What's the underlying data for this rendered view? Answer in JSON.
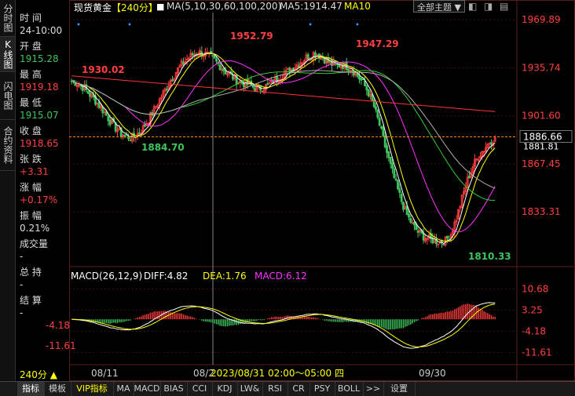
{
  "left_tabs": [
    "分时图",
    "K线图",
    "闪电图",
    "合约资料"
  ],
  "info_panel": [
    {
      "label": "时 间",
      "value": "24-10:00",
      "value_color": "#dddddd"
    },
    {
      "label": "开 盘",
      "value": "1915.28",
      "value_color": "#3ec45d"
    },
    {
      "label": "最 高",
      "value": "1919.18",
      "value_color": "#ff4040"
    },
    {
      "label": "最 低",
      "value": "1915.07",
      "value_color": "#3ec45d"
    },
    {
      "label": "收 盘",
      "value": "1918.65",
      "value_color": "#ff4040"
    },
    {
      "label": "张 跌",
      "value": "+3.31",
      "value_color": "#ff4040"
    },
    {
      "label": "涨 幅",
      "value": "+0.17%",
      "value_color": "#ff4040"
    },
    {
      "label": "振 幅",
      "value": "0.21%",
      "value_color": "#dddddd"
    },
    {
      "label": "成交量",
      "value": "-",
      "value_color": "#dddddd"
    },
    {
      "label": "总 持",
      "value": "-",
      "value_color": "#dddddd"
    },
    {
      "label": "结 算",
      "value": "-",
      "value_color": "#dddddd"
    }
  ],
  "header": {
    "symbol": "现货黄金",
    "period_tag": "【240分】",
    "ma_label": "MA(5,10,30,60,100,200)",
    "ma5_label": "MA5:1914.47",
    "ma10_label": "MA10",
    "topic_button": "全部主题 ▼",
    "page_icons": [
      "◧",
      "◨",
      "▤"
    ]
  },
  "macd_header": {
    "title": "MACD(26,12,9)",
    "diff": "DIFF:4.82",
    "dea": "DEA:1.76",
    "macd": "MACD:6.12"
  },
  "chart_data": [
    {
      "type": "candlestick",
      "y_axis_ticks": [
        "1969.89",
        "1935.74",
        "1901.60",
        "1867.45",
        "1833.31"
      ],
      "ylim": [
        1800,
        1975
      ],
      "current_price": "1886.66",
      "current_price_alt": "1881.81",
      "annotations": [
        {
          "text": "1930.02",
          "color": "#ff4040"
        },
        {
          "text": "1884.70",
          "color": "#3ec45d"
        },
        {
          "text": "1952.79",
          "color": "#ff4040"
        },
        {
          "text": "1947.29",
          "color": "#ff4040"
        },
        {
          "text": "1810.33",
          "color": "#3ec45d"
        }
      ],
      "x_ticks": [
        "08/11",
        "08/2",
        "09/30"
      ],
      "crosshair_label": "2023/08/31 02:00～05:00 四",
      "close_path": [
        1926,
        1925,
        1922,
        1918,
        1914,
        1909,
        1904,
        1898,
        1893,
        1889,
        1887,
        1886,
        1889,
        1893,
        1899,
        1906,
        1913,
        1920,
        1927,
        1933,
        1938,
        1942,
        1945,
        1947,
        1946,
        1944,
        1941,
        1937,
        1933,
        1930,
        1927,
        1925,
        1924,
        1922,
        1921,
        1922,
        1924,
        1927,
        1930,
        1932,
        1935,
        1938,
        1941,
        1944,
        1946,
        1945,
        1942,
        1939,
        1937,
        1938,
        1937,
        1935,
        1930,
        1925,
        1918,
        1908,
        1895,
        1880,
        1866,
        1853,
        1841,
        1831,
        1824,
        1819,
        1816,
        1814,
        1813,
        1812,
        1813,
        1818,
        1829,
        1843,
        1856,
        1866,
        1873,
        1878,
        1883,
        1886
      ],
      "ma_series": [
        {
          "name": "MA5",
          "color": "#ffffff"
        },
        {
          "name": "MA10",
          "color": "#ffff00"
        },
        {
          "name": "MA30",
          "color": "#ff33ff"
        },
        {
          "name": "MA60",
          "color": "#33cc33"
        },
        {
          "name": "MA100",
          "color": "#b0b0b0"
        },
        {
          "name": "MA200",
          "color": "#ff3333"
        }
      ]
    },
    {
      "type": "bar",
      "name": "MACD",
      "y_axis_ticks": [
        "10.68",
        "3.25",
        "-4.18",
        "-11.61"
      ],
      "ylim": [
        -14,
        13
      ]
    }
  ],
  "bottom_tabs": [
    "指标",
    "模板",
    "VIP指标",
    "MA",
    "MACD",
    "BIAS",
    "CCI",
    "KDJ",
    "LW&",
    "RSI",
    "CR",
    "PSY",
    "BOLL",
    ">>",
    "设置"
  ],
  "period_selector": "240分 ▲",
  "colors": {
    "up": "#ff3c3c",
    "down": "#3ec45d",
    "grid": "#3a1a1a",
    "axis_text": "#ff4040"
  }
}
